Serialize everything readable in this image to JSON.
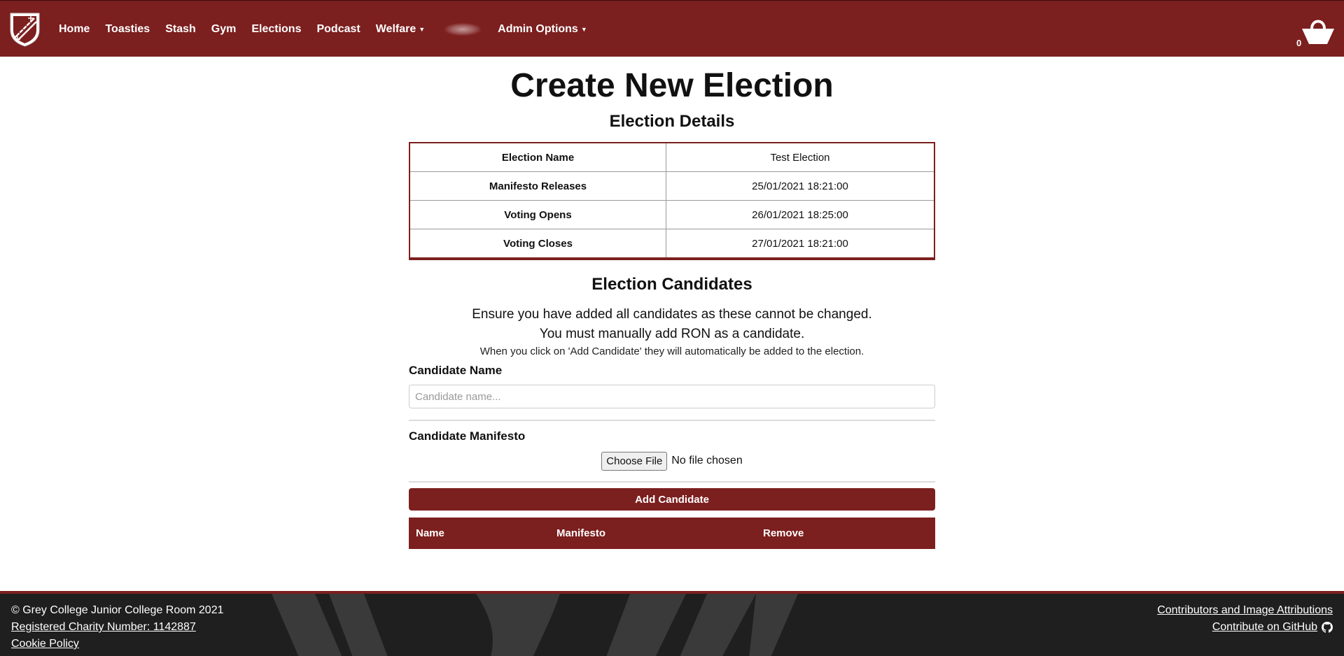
{
  "nav": {
    "items": [
      {
        "label": "Home"
      },
      {
        "label": "Toasties"
      },
      {
        "label": "Stash"
      },
      {
        "label": "Gym"
      },
      {
        "label": "Elections"
      },
      {
        "label": "Podcast"
      },
      {
        "label": "Welfare"
      }
    ],
    "admin_label": "Admin Options",
    "cart_count": "0"
  },
  "page": {
    "title": "Create New Election",
    "details_title": "Election Details",
    "details": [
      {
        "label": "Election Name",
        "value": "Test Election"
      },
      {
        "label": "Manifesto Releases",
        "value": "25/01/2021 18:21:00"
      },
      {
        "label": "Voting Opens",
        "value": "26/01/2021 18:25:00"
      },
      {
        "label": "Voting Closes",
        "value": "27/01/2021 18:21:00"
      }
    ],
    "candidates_title": "Election Candidates",
    "warning_1": "Ensure you have added all candidates as these cannot be changed.",
    "warning_2": "You must manually add RON as a candidate.",
    "hint": "When you click on 'Add Candidate' they will automatically be added to the election.",
    "name_label": "Candidate Name",
    "name_placeholder": "Candidate name...",
    "manifesto_label": "Candidate Manifesto",
    "file_button": "Choose File",
    "file_status": "No file chosen",
    "add_button": "Add Candidate",
    "table_headers": [
      "Name",
      "Manifesto",
      "Remove"
    ]
  },
  "footer": {
    "copyright": "© Grey College Junior College Room 2021",
    "charity": "Registered Charity Number: 1142887",
    "cookie": "Cookie Policy",
    "contributors": "Contributors and Image Attributions",
    "github": "Contribute on GitHub"
  },
  "colors": {
    "brand": "#7c1f1f",
    "footer_bg": "#1f1f1f"
  }
}
